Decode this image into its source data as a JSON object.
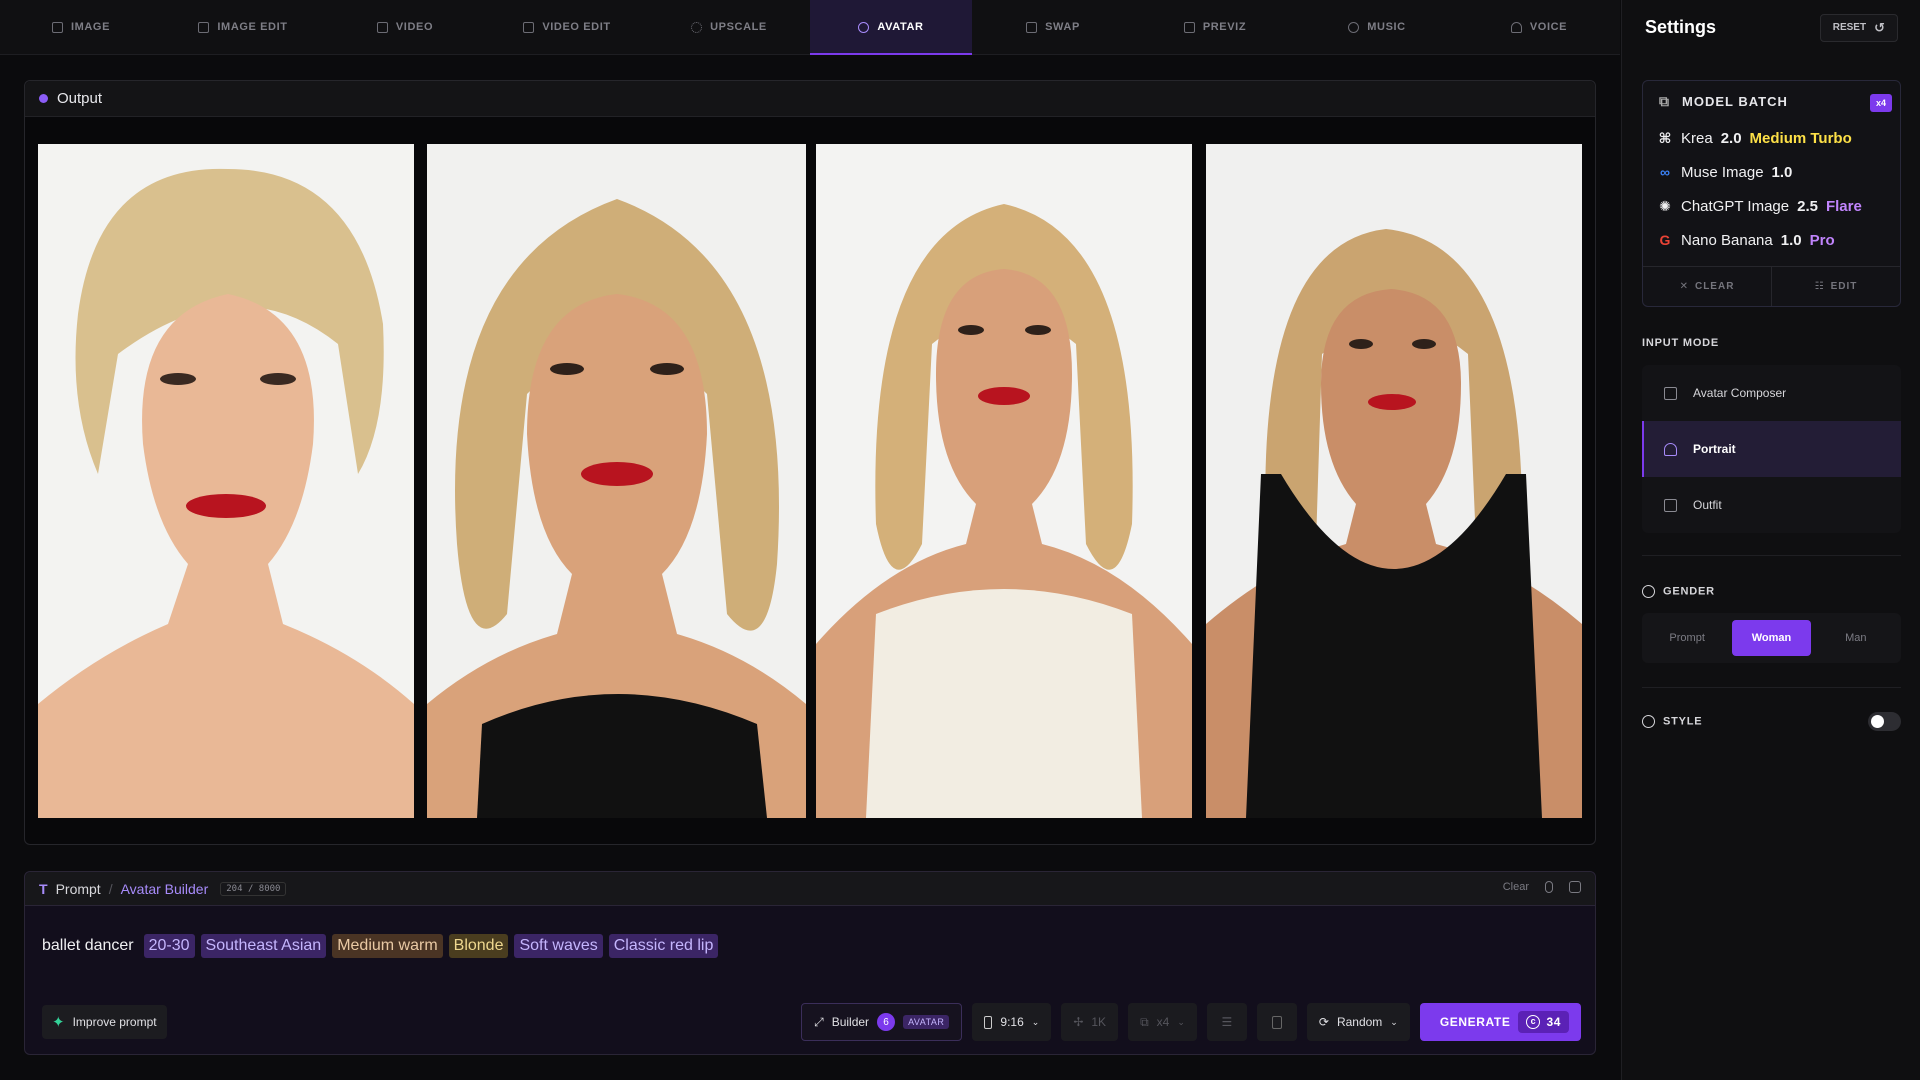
{
  "nav": {
    "tabs": [
      {
        "label": "IMAGE",
        "icon": "image-icon"
      },
      {
        "label": "IMAGE EDIT",
        "icon": "image-edit-icon"
      },
      {
        "label": "VIDEO",
        "icon": "video-icon"
      },
      {
        "label": "VIDEO EDIT",
        "icon": "video-edit-icon"
      },
      {
        "label": "UPSCALE",
        "icon": "upscale-icon"
      },
      {
        "label": "AVATAR",
        "icon": "avatar-icon",
        "active": true
      },
      {
        "label": "SWAP",
        "icon": "swap-icon"
      },
      {
        "label": "PREVIZ",
        "icon": "previz-icon"
      },
      {
        "label": "MUSIC",
        "icon": "music-icon"
      },
      {
        "label": "VOICE",
        "icon": "voice-icon"
      }
    ]
  },
  "output": {
    "title": "Output"
  },
  "prompt": {
    "label": "Prompt",
    "builder_link": "Avatar Builder",
    "char_count": "204 / 8000",
    "clear_label": "Clear",
    "text": "ballet dancer",
    "chips": [
      "20-30",
      "Southeast Asian",
      "Medium warm",
      "Blonde",
      "Soft waves",
      "Classic red lip"
    ],
    "improve_label": "Improve prompt",
    "builder_label": "Builder",
    "builder_count": "6",
    "builder_badge": "AVATAR",
    "aspect": "9:16",
    "resolution": "1K",
    "batch": "x4",
    "seed": "Random",
    "generate_label": "GENERATE",
    "generate_cost": "34"
  },
  "settings": {
    "title": "Settings",
    "reset_label": "RESET",
    "batch": {
      "title": "MODEL BATCH",
      "badge": "x4",
      "models": [
        {
          "name": "Krea",
          "version": "2.0",
          "variant": "Medium Turbo",
          "variant_color": "#fde047",
          "icon": "krea-icon"
        },
        {
          "name": "Muse Image",
          "version": "1.0",
          "variant": "",
          "variant_color": "#fff",
          "icon": "meta-icon"
        },
        {
          "name": "ChatGPT Image",
          "version": "2.5",
          "variant": "Flare",
          "variant_color": "#c084fc",
          "icon": "openai-icon"
        },
        {
          "name": "Nano Banana",
          "version": "1.0",
          "variant": "Pro",
          "variant_color": "#c084fc",
          "icon": "google-icon"
        }
      ],
      "clear_label": "CLEAR",
      "edit_label": "EDIT"
    },
    "input_mode": {
      "label": "INPUT MODE",
      "modes": [
        "Avatar Composer",
        "Portrait",
        "Outfit"
      ],
      "selected": "Portrait"
    },
    "gender": {
      "label": "GENDER",
      "options": [
        "Prompt",
        "Woman",
        "Man"
      ],
      "selected": "Woman"
    },
    "style": {
      "label": "STYLE",
      "enabled": false
    }
  },
  "colors": {
    "accent": "#7c3aed",
    "accent_light": "#a78bfa"
  }
}
